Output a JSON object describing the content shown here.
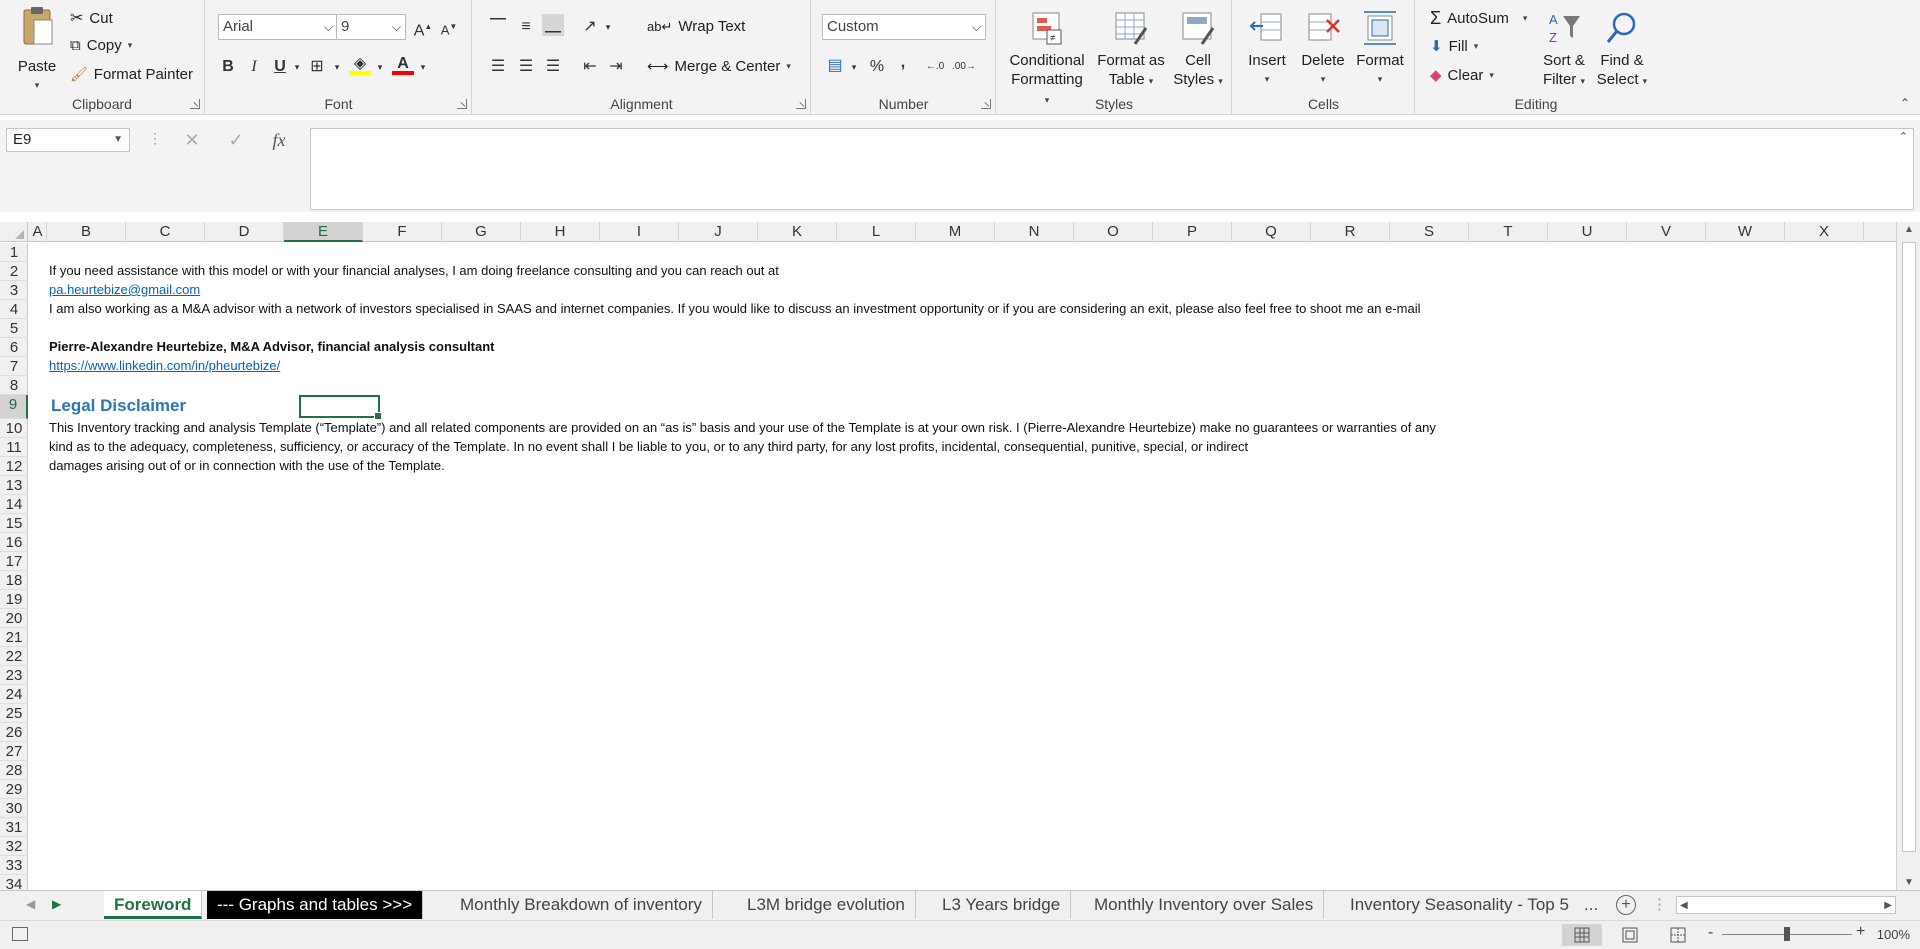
{
  "clipboard": {
    "paste": "Paste",
    "cut": "Cut",
    "copy": "Copy",
    "format_painter": "Format Painter",
    "label": "Clipboard"
  },
  "font": {
    "name": "Arial",
    "size": "9",
    "label": "Font",
    "bold": "B",
    "italic": "I",
    "underline": "U"
  },
  "alignment": {
    "wrap_text": "Wrap Text",
    "merge_center": "Merge & Center",
    "label": "Alignment"
  },
  "number": {
    "format": "Custom",
    "label": "Number",
    "percent": "%",
    "comma": ","
  },
  "styles": {
    "conditional": "Conditional",
    "formatting": "Formatting",
    "format_as": "Format as",
    "table": "Table",
    "cell": "Cell",
    "cell_styles": "Styles",
    "label": "Styles"
  },
  "cells": {
    "insert": "Insert",
    "delete": "Delete",
    "format": "Format",
    "label": "Cells"
  },
  "editing": {
    "autosum": "AutoSum",
    "fill": "Fill",
    "clear": "Clear",
    "sort": "Sort &",
    "filter": "Filter",
    "find": "Find &",
    "select": "Select",
    "label": "Editing"
  },
  "formula_bar": {
    "name_box": "E9",
    "fx": "fx",
    "value": ""
  },
  "columns": [
    "A",
    "B",
    "C",
    "D",
    "E",
    "F",
    "G",
    "H",
    "I",
    "J",
    "K",
    "L",
    "M",
    "N",
    "O",
    "P",
    "Q",
    "R",
    "S",
    "T",
    "U",
    "V",
    "W",
    "X"
  ],
  "rows": [
    "1",
    "2",
    "3",
    "4",
    "5",
    "6",
    "7",
    "8",
    "9",
    "10",
    "11",
    "12",
    "13",
    "14",
    "15",
    "16",
    "17",
    "18",
    "19",
    "20",
    "21",
    "22",
    "23",
    "24",
    "25",
    "26",
    "27",
    "28",
    "29",
    "30",
    "31",
    "32",
    "33",
    "34"
  ],
  "content": {
    "line2": "If you need assistance with this model or with your financial analyses, I am doing freelance consulting and you can reach out at",
    "email": "pa.heurtebize@gmail.com",
    "line4": "I am also working as a M&A advisor with a network of investors specialised in SAAS and internet companies. If you would like to discuss an investment opportunity or if you are considering an exit, please also feel free to shoot me an e-mail",
    "author": "Pierre-Alexandre Heurtebize, M&A Advisor, financial analysis consultant",
    "linkedin": "https://www.linkedin.com/in/pheurtebize/",
    "disclaimer_title": "Legal Disclaimer",
    "line10": "This Inventory tracking and analysis Template (“Template”) and all related components are provided on an “as is” basis and your use of the Template is at your own risk.  I (Pierre-Alexandre Heurtebize) make no guarantees or warranties of any",
    "line11": "kind as to the adequacy, completeness, sufficiency, or accuracy of the Template. In no event shall I be liable to you, or to any third party, for any lost profits, incidental, consequential, punitive, special, or indirect",
    "line12": "damages arising out of or in connection with the use of the Template."
  },
  "tabs": [
    "Foreword",
    "--- Graphs and tables >>>",
    "Monthly Breakdown of inventory",
    "L3M bridge evolution",
    "L3 Years bridge",
    "Monthly Inventory over Sales",
    "Inventory Seasonality - Top 5",
    "..."
  ],
  "status": {
    "zoom": "100%",
    "zoom_minus": "-",
    "zoom_plus": "+"
  }
}
